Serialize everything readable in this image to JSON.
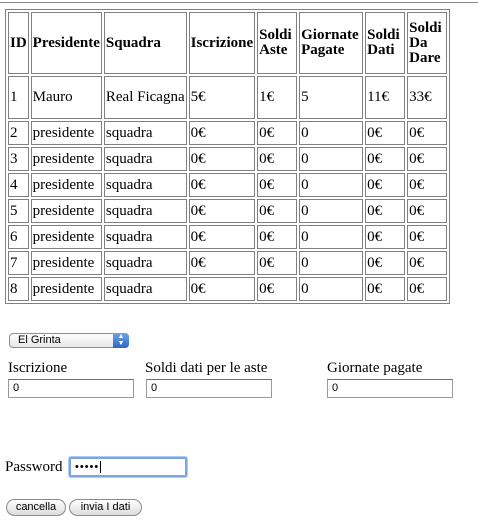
{
  "table": {
    "headers": [
      "ID",
      "Presidente",
      "Squadra",
      "Iscrizione",
      "Soldi Aste",
      "Giornate Pagate",
      "Soldi Dati",
      "Soldi Da Dare"
    ],
    "rows": [
      [
        "1",
        "Mauro",
        "Real Ficagna",
        "5€",
        "1€",
        "5",
        "11€",
        "33€"
      ],
      [
        "2",
        "presidente",
        "squadra",
        "0€",
        "0€",
        "0",
        "0€",
        "0€"
      ],
      [
        "3",
        "presidente",
        "squadra",
        "0€",
        "0€",
        "0",
        "0€",
        "0€"
      ],
      [
        "4",
        "presidente",
        "squadra",
        "0€",
        "0€",
        "0",
        "0€",
        "0€"
      ],
      [
        "5",
        "presidente",
        "squadra",
        "0€",
        "0€",
        "0",
        "0€",
        "0€"
      ],
      [
        "6",
        "presidente",
        "squadra",
        "0€",
        "0€",
        "0",
        "0€",
        "0€"
      ],
      [
        "7",
        "presidente",
        "squadra",
        "0€",
        "0€",
        "0",
        "0€",
        "0€"
      ],
      [
        "8",
        "presidente",
        "squadra",
        "0€",
        "0€",
        "0",
        "0€",
        "0€"
      ]
    ]
  },
  "form": {
    "team_select": "El Grinta",
    "iscrizione_label": "Iscrizione",
    "iscrizione_value": "0",
    "soldi_aste_label": "Soldi dati per le aste",
    "soldi_aste_value": "0",
    "giornate_label": "Giornate pagate",
    "giornate_value": "0",
    "password_label": "Password",
    "password_masked": "•••••",
    "cancel_label": "cancella",
    "submit_label": "invia I dati"
  }
}
